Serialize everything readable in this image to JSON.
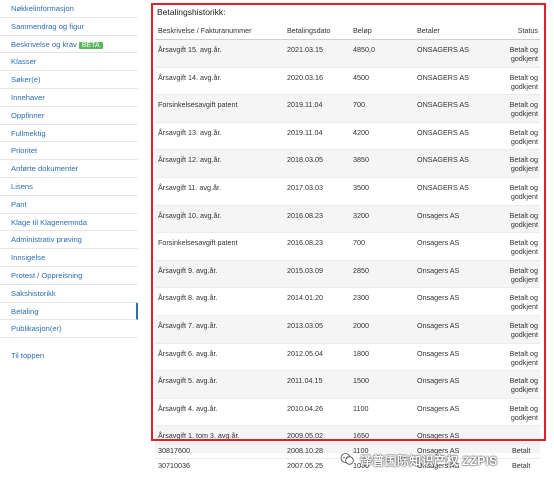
{
  "sidebar": {
    "items": [
      {
        "label": "Nøkkelinformasjon"
      },
      {
        "label": "Sammendrag og figur"
      },
      {
        "label": "Beskrivelse og krav",
        "badge": "BETA"
      },
      {
        "label": "Klasser"
      },
      {
        "label": "Søker(e)"
      },
      {
        "label": "Innehaver"
      },
      {
        "label": "Oppfinner"
      },
      {
        "label": "Fullmektig"
      },
      {
        "label": "Prioritet"
      },
      {
        "label": "Anførte dokumenter"
      },
      {
        "label": "Lisens"
      },
      {
        "label": "Pant"
      },
      {
        "label": "Klage til Klagenemnda"
      },
      {
        "label": "Administrativ prøving"
      },
      {
        "label": "Innsigelse"
      },
      {
        "label": "Protest / Oppreisning"
      },
      {
        "label": "Sakshistorikk"
      },
      {
        "label": "Betaling",
        "active": true
      },
      {
        "label": "Publikasjon(er)"
      }
    ],
    "back_to_top": "Til toppen"
  },
  "section_title": "Betalingshistorikk:",
  "table": {
    "headers": [
      "Beskrivelse / Fakturanummer",
      "Betalingsdato",
      "Beløp",
      "Betaler",
      "Status"
    ],
    "rows": [
      [
        "Årsavgift 15. avg.år.",
        "2021.03.15",
        "4850,0",
        "ONSAGERS AS",
        "Betalt og godkjent"
      ],
      [
        "Årsavgift 14. avg.år.",
        "2020.03.16",
        "4500",
        "ONSAGERS AS",
        "Betalt og godkjent"
      ],
      [
        "Forsinkelsesavgift patent",
        "2019.11.04",
        "700",
        "ONSAGERS AS",
        "Betalt og godkjent"
      ],
      [
        "Årsavgift 13. avg.år.",
        "2019.11.04",
        "4200",
        "ONSAGERS AS",
        "Betalt og godkjent"
      ],
      [
        "Årsavgift 12. avg.år.",
        "2018.03.05",
        "3850",
        "ONSAGERS AS",
        "Betalt og godkjent"
      ],
      [
        "Årsavgift 11. avg.år.",
        "2017.03.03",
        "3500",
        "ONSAGERS AS",
        "Betalt og godkjent"
      ],
      [
        "Årsavgift 10. avg.år.",
        "2016.08.23",
        "3200",
        "Onsagers AS",
        "Betalt og godkjent"
      ],
      [
        "Forsinkelsesavgift patent",
        "2016.08.23",
        "700",
        "Onsagers AS",
        "Betalt og godkjent"
      ],
      [
        "Årsavgift 9. avg.år.",
        "2015.03.09",
        "2850",
        "Onsagers AS",
        "Betalt og godkjent"
      ],
      [
        "Årsavgift 8. avg.år.",
        "2014.01.20",
        "2300",
        "Onsagers AS",
        "Betalt og godkjent"
      ],
      [
        "Årsavgift 7. avg.år.",
        "2013.03.05",
        "2000",
        "Onsagers AS",
        "Betalt og godkjent"
      ],
      [
        "Årsavgift 6. avg.år.",
        "2012.05.04",
        "1800",
        "Onsagers AS",
        "Betalt og godkjent"
      ],
      [
        "Årsavgift 5. avg.år.",
        "2011.04.15",
        "1500",
        "Onsagers AS",
        "Betalt og godkjent"
      ],
      [
        "Årsavgift 4. avg.år.",
        "2010.04.26",
        "1100",
        "Onsagers AS",
        "Betalt og godkjent"
      ],
      [
        "Årsavgift 1. tom 3. avg.år.",
        "2009.05.02",
        "1650",
        "Onsagers AS",
        ""
      ]
    ],
    "extra_rows": [
      [
        "30817600",
        "2008.10.28",
        "1100",
        "Onsagers AS",
        "Betalt"
      ],
      [
        "30710036",
        "2007.05.25",
        "1000",
        "Onsagers AS",
        "Betalt"
      ]
    ]
  },
  "watermark": {
    "text": "泽普国际知识产权 ZZPIS"
  },
  "colors": {
    "link": "#2c6fb2",
    "highlight_border": "#e0202a",
    "beta_badge": "#5cb85c"
  }
}
